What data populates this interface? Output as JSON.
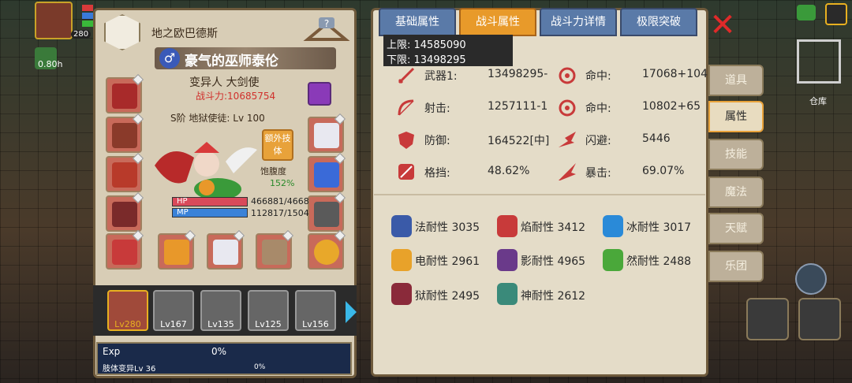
{
  "hud": {
    "level": "280",
    "timer": "0.80h",
    "storage_label": "仓库"
  },
  "character": {
    "title_top": "地之欧巴德斯",
    "name": "豪气的巫师泰伦",
    "job": "变异人 大剑使",
    "power": "战斗力:10685754",
    "rank": "S阶 地狱使徒: Lv 100",
    "extra_skill": "额外技体",
    "satiety_label": "饱腹度",
    "satiety_value": "152%",
    "hp_label": "HP",
    "hp_value": "466881/4668",
    "mp_label": "MP",
    "mp_value": "112817/1504",
    "hp_fill": 1.0,
    "mp_fill": 0.75
  },
  "party": [
    {
      "level": "Lv280",
      "selected": true
    },
    {
      "level": "Lv167",
      "selected": false
    },
    {
      "level": "Lv135",
      "selected": false
    },
    {
      "level": "Lv125",
      "selected": false
    },
    {
      "level": "Lv156",
      "selected": false
    }
  ],
  "exp": {
    "label": "Exp",
    "value": "0%",
    "sub_label": "肢体变异Lv 36",
    "sub_value": "0%"
  },
  "tabs": [
    "基础属性",
    "战斗属性",
    "战斗力详情",
    "极限突破"
  ],
  "active_tab": 1,
  "tooltip": {
    "upper": "上限: 14585090",
    "lower": "下限: 13498295"
  },
  "stats": [
    {
      "label": "武器1:",
      "value": "13498295-",
      "icon": "sword-icon"
    },
    {
      "label": "命中:",
      "value": "17068+104",
      "icon": "target-icon"
    },
    {
      "label": "射击:",
      "value": "1257111-1",
      "icon": "bow-icon"
    },
    {
      "label": "命中:",
      "value": "10802+65",
      "icon": "target-icon"
    },
    {
      "label": "防御:",
      "value": "164522[中]",
      "icon": "shield-icon"
    },
    {
      "label": "闪避:",
      "value": "5446",
      "icon": "dodge-icon"
    },
    {
      "label": "格挡:",
      "value": "48.62%",
      "icon": "block-icon"
    },
    {
      "label": "暴击:",
      "value": "69.07%",
      "icon": "crit-icon"
    }
  ],
  "resistances": [
    {
      "text": "法耐性 3035",
      "color": "#3a5aa8",
      "icon": "magic-resist-icon"
    },
    {
      "text": "焰耐性 3412",
      "color": "#c83a3a",
      "icon": "fire-resist-icon"
    },
    {
      "text": "冰耐性 3017",
      "color": "#2a8ad8",
      "icon": "ice-resist-icon"
    },
    {
      "text": "电耐性 2961",
      "color": "#e8a22a",
      "icon": "lightning-resist-icon"
    },
    {
      "text": "影耐性 4965",
      "color": "#6a3a8a",
      "icon": "shadow-resist-icon"
    },
    {
      "text": "然耐性 2488",
      "color": "#4aa83a",
      "icon": "nature-resist-icon"
    },
    {
      "text": "狱耐性 2495",
      "color": "#8a2a3a",
      "icon": "hell-resist-icon"
    },
    {
      "text": "神耐性 2612",
      "color": "#3a8a7a",
      "icon": "divine-resist-icon"
    }
  ],
  "side_tabs": [
    "道具",
    "属性",
    "技能",
    "魔法",
    "天赋",
    "乐团"
  ],
  "active_side_tab": 1
}
